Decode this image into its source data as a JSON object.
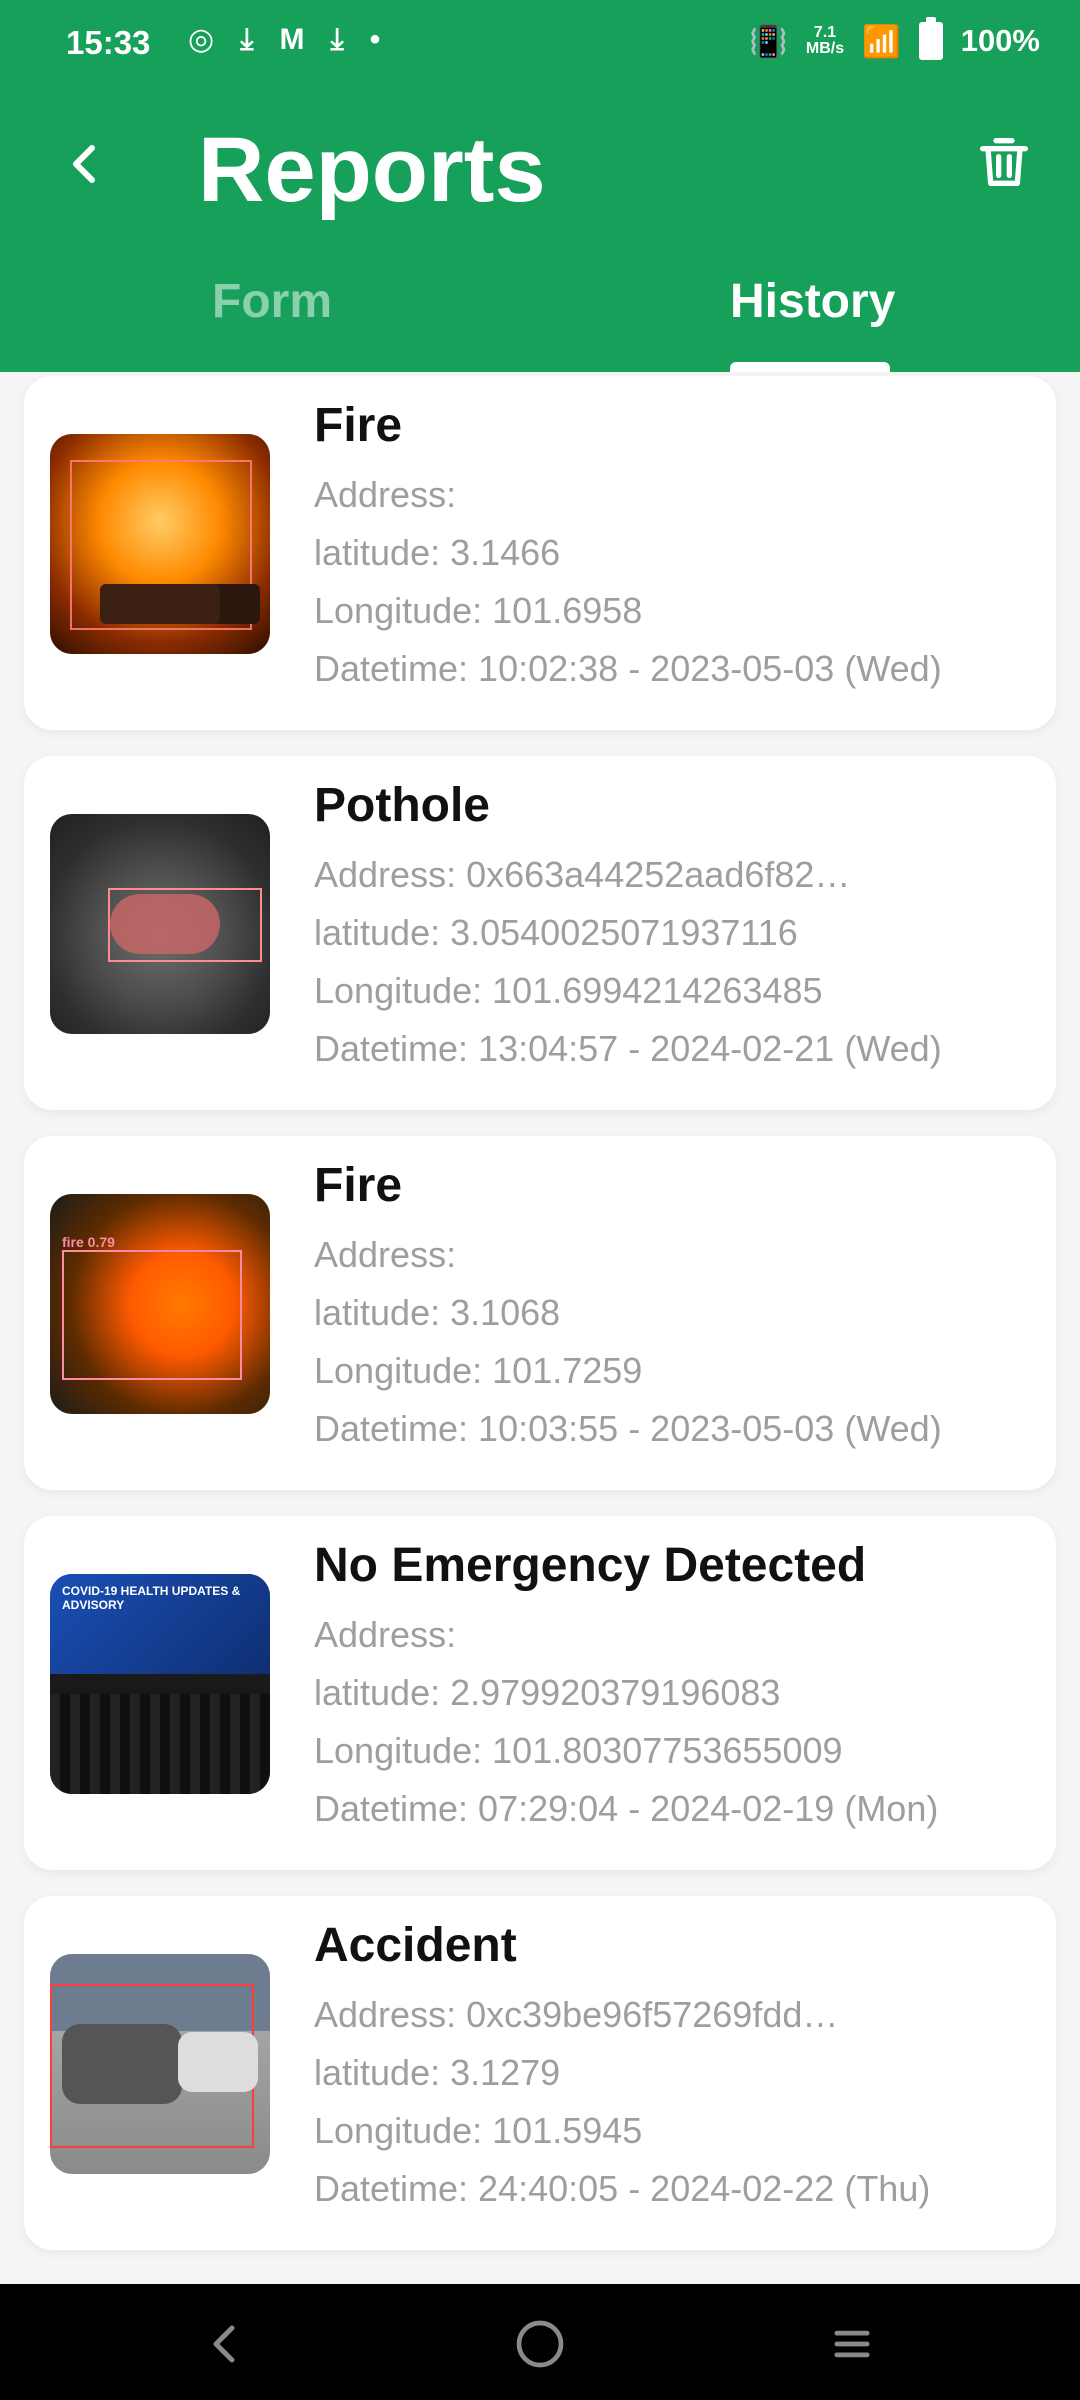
{
  "status_bar": {
    "time": "15:33",
    "speed_value": "7.1",
    "speed_unit": "MB/s",
    "battery": "100%"
  },
  "app_bar": {
    "title": "Reports",
    "back_icon": "back-arrow-icon",
    "delete_icon": "trash-icon"
  },
  "tabs": [
    {
      "label": "Form",
      "selected": false
    },
    {
      "label": "History",
      "selected": true
    }
  ],
  "reports": [
    {
      "title": "Fire",
      "address": "Address:",
      "latitude": "latitude: 3.1466",
      "longitude": "Longitude: 101.6958",
      "datetime": "Datetime: 10:02:38 - 2023-05-03 (Wed)"
    },
    {
      "title": "Pothole",
      "address": "Address: 0x663a44252aad6f82…",
      "latitude": "latitude: 3.0540025071937116",
      "longitude": "Longitude: 101.6994214263485",
      "datetime": "Datetime: 13:04:57 - 2024-02-21 (Wed)"
    },
    {
      "title": "Fire",
      "address": "Address:",
      "latitude": "latitude: 3.1068",
      "longitude": "Longitude: 101.7259",
      "datetime": "Datetime: 10:03:55 - 2023-05-03 (Wed)"
    },
    {
      "title": "No Emergency Detected",
      "address": "Address:",
      "latitude": "latitude: 2.979920379196083",
      "longitude": "Longitude: 101.80307753655009",
      "datetime": "Datetime: 07:29:04 - 2024-02-19 (Mon)"
    },
    {
      "title": "Accident",
      "address": "Address: 0xc39be96f57269fdd…",
      "latitude": "latitude: 3.1279",
      "longitude": "Longitude: 101.5945",
      "datetime": "Datetime: 24:40:05 - 2024-02-22 (Thu)"
    }
  ],
  "thumbnails": {
    "fire2_label": "fire 0.79",
    "covid_text": "COVID-19 HEALTH UPDATES & ADVISORY"
  },
  "nav": {
    "back": "nav-back-icon",
    "home": "nav-home-icon",
    "recent": "nav-recent-icon"
  },
  "colors": {
    "primary": "#16a05a",
    "text_secondary": "#9e9e9e",
    "card_bg": "#ffffff",
    "navbar_bg": "#000000"
  }
}
